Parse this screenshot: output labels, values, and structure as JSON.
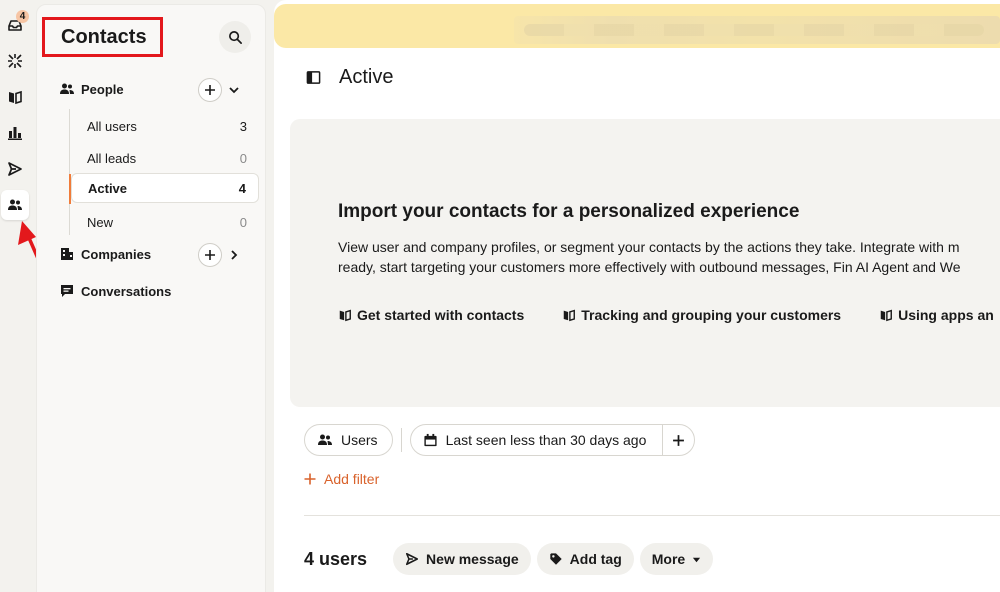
{
  "rail": {
    "inbox_badge": "4",
    "items": [
      {
        "icon": "inbox-icon"
      },
      {
        "icon": "fin-ai-icon"
      },
      {
        "icon": "knowledge-book-icon"
      },
      {
        "icon": "reports-chart-icon"
      },
      {
        "icon": "outbound-send-icon"
      },
      {
        "icon": "contacts-people-icon",
        "active": true
      }
    ]
  },
  "nav": {
    "title": "Contacts",
    "people": {
      "label": "People",
      "items": [
        {
          "label": "All users",
          "count": "3"
        },
        {
          "label": "All leads",
          "count": "0"
        },
        {
          "label": "Active",
          "count": "4",
          "active": true
        },
        {
          "label": "New",
          "count": "0"
        }
      ]
    },
    "companies_label": "Companies",
    "conversations_label": "Conversations"
  },
  "main": {
    "title": "Active",
    "promo": {
      "title": "Import your contacts for a personalized experience",
      "line1": "View user and company profiles, or segment your contacts by the actions they take. Integrate with m",
      "line2": "ready, start targeting your customers more effectively with outbound messages, Fin AI Agent and We",
      "links": [
        "Get started with contacts",
        "Tracking and grouping your customers",
        "Using apps an"
      ]
    },
    "filters": {
      "users_label": "Users",
      "last_seen_label": "Last seen less than 30 days ago",
      "add_filter_label": "Add filter"
    },
    "list": {
      "count_label": "4 users",
      "new_message_label": "New message",
      "add_tag_label": "Add tag",
      "more_label": "More"
    }
  },
  "colors": {
    "accent_orange": "#f07c3a",
    "add_filter_orange": "#d9622b",
    "annotation_red": "#e3181c",
    "banner_yellow": "#fbe8a6"
  }
}
